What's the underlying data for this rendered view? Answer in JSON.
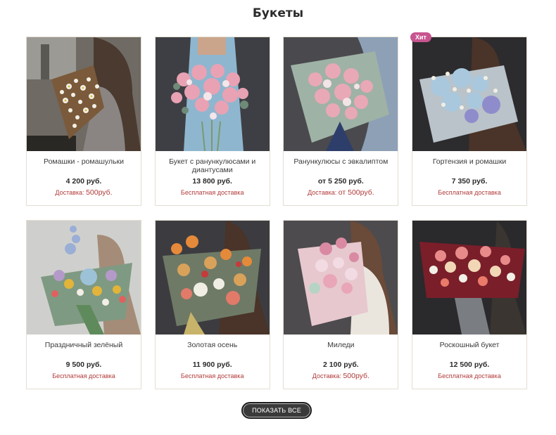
{
  "page": {
    "title": "Букеты"
  },
  "products": [
    {
      "name": "Ромашки - ромашульки",
      "price": "4 200 руб.",
      "delivery_label": "Доставка:",
      "delivery_amount": "500руб.",
      "badge": "",
      "image": "chamomile-bouquet-photo"
    },
    {
      "name": "Букет с ранункулюсами и диантусами",
      "price": "13 800 руб.",
      "delivery_label": "Бесплатная доставка",
      "delivery_amount": "",
      "badge": "",
      "image": "ranunculus-dianthus-bouquet-photo"
    },
    {
      "name": "Ранункулюсы с эвкалиптом",
      "price": "от 5 250 руб.",
      "delivery_label": "Доставка:",
      "delivery_amount": "от 500руб.",
      "badge": "",
      "image": "ranunculus-eucalyptus-bouquet-photo"
    },
    {
      "name": "Гортензия и ромашки",
      "price": "7 350 руб.",
      "delivery_label": "Бесплатная доставка",
      "delivery_amount": "",
      "badge": "Хит",
      "image": "hydrangea-chamomile-bouquet-photo"
    },
    {
      "name": "Праздничный зелёный",
      "price": "9 500 руб.",
      "delivery_label": "Бесплатная доставка",
      "delivery_amount": "",
      "badge": "",
      "image": "festive-green-bouquet-photo"
    },
    {
      "name": "Золотая осень",
      "price": "11 900 руб.",
      "delivery_label": "Бесплатная доставка",
      "delivery_amount": "",
      "badge": "",
      "image": "golden-autumn-bouquet-photo"
    },
    {
      "name": "Миледи",
      "price": "2 100 руб.",
      "delivery_label": "Доставка:",
      "delivery_amount": "500руб.",
      "badge": "",
      "image": "milady-bouquet-photo"
    },
    {
      "name": "Роскошный букет",
      "price": "12 500 руб.",
      "delivery_label": "Бесплатная доставка",
      "delivery_amount": "",
      "badge": "",
      "image": "luxurious-bouquet-photo"
    }
  ],
  "actions": {
    "show_all_label": "ПОКАЗАТЬ ВСЕ"
  },
  "colors": {
    "accent_red": "#b23a3a",
    "badge_pink": "#c8558f",
    "button_dark": "#3a3a3a",
    "card_border": "#e4ddd2"
  }
}
